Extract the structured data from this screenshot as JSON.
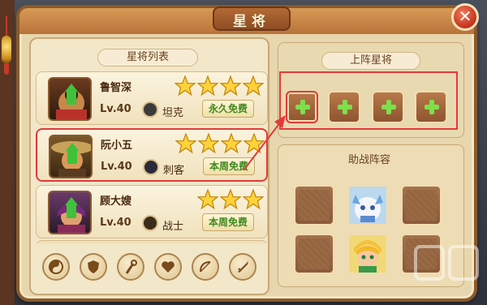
{
  "window": {
    "title": "星将"
  },
  "left": {
    "section_title": "星将列表",
    "heroes": [
      {
        "name": "鲁智深",
        "level": "Lv.40",
        "class": "坦克",
        "class_icon": "shield-icon",
        "free_label": "永久免费",
        "stars": 4
      },
      {
        "name": "阮小五",
        "level": "Lv.40",
        "class": "刺客",
        "class_icon": "dagger-icon",
        "free_label": "本周免费",
        "stars": 4,
        "selected": true
      },
      {
        "name": "顾大嫂",
        "level": "Lv.40",
        "class": "战士",
        "class_icon": "sword-icon",
        "free_label": "本周免费",
        "stars": 3
      }
    ],
    "filter_icons": [
      "yin-yang-icon",
      "shield-icon",
      "staff-icon",
      "heart-icon",
      "bow-icon",
      "sword-icon"
    ]
  },
  "right": {
    "deploy_title": "上阵星将",
    "deploy_slots": 4,
    "support_title": "助战阵容",
    "support_grid": [
      {
        "type": "empty"
      },
      {
        "type": "hero",
        "icon": "white-dragon-avatar"
      },
      {
        "type": "empty"
      },
      {
        "type": "empty"
      },
      {
        "type": "hero",
        "icon": "blonde-warrior-avatar"
      },
      {
        "type": "empty"
      }
    ]
  },
  "colors": {
    "highlight": "#e23a3a",
    "free_text": "#3e8a1e",
    "plus": "#7ce04a"
  }
}
